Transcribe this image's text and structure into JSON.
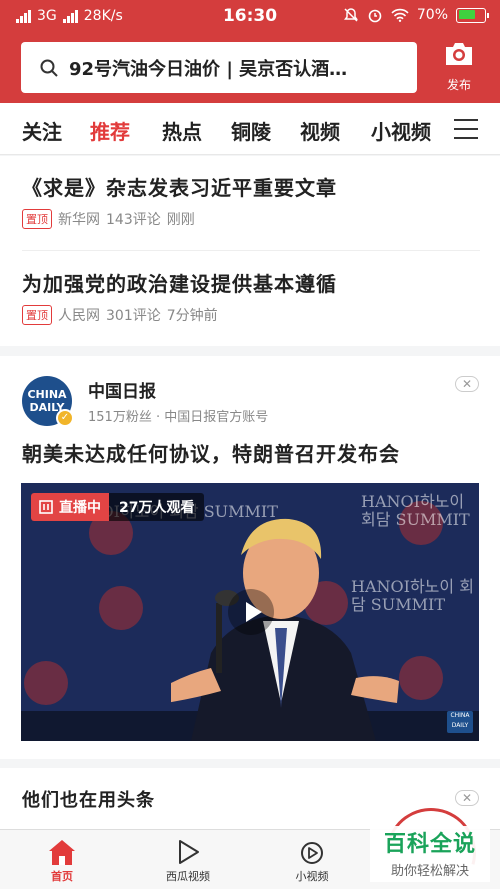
{
  "status_bar": {
    "network": "3G",
    "speed": "28K/s",
    "time": "16:30",
    "battery": "70%",
    "battery_level": 0.7
  },
  "header": {
    "search_text": "92号汽油今日油价 | 吴京否认酒…",
    "publish_label": "发布",
    "icons": [
      "search-icon",
      "camera-icon"
    ]
  },
  "tabs": [
    {
      "label": "关注",
      "active": false
    },
    {
      "label": "推荐",
      "active": true
    },
    {
      "label": "热点",
      "active": false
    },
    {
      "label": "铜陵",
      "active": false
    },
    {
      "label": "视频",
      "active": false
    },
    {
      "label": "小视频",
      "active": false
    }
  ],
  "news": [
    {
      "title": "《求是》杂志发表习近平重要文章",
      "badge": "置顶",
      "source": "新华网",
      "comments": "143评论",
      "time": "刚刚"
    },
    {
      "title": "为加强党的政治建设提供基本遵循",
      "badge": "置顶",
      "source": "人民网",
      "comments": "301评论",
      "time": "7分钟前"
    }
  ],
  "video_card": {
    "avatar_text": "CHINA DAILY",
    "account": "中国日报",
    "followers": "151万粉丝 · 中国日报官方账号",
    "title": "朝美未达成任何协议，特朗普召开发布会",
    "live_label": "直播中",
    "viewers": "27万人观看",
    "bg_text": "HANOI하노이 회담 SUMMIT",
    "watermark": "CHINA DAILY"
  },
  "suggest_card": {
    "title": "他们也在用头条"
  },
  "bottom_nav": [
    {
      "label": "首页",
      "icon": "home-icon",
      "active": true
    },
    {
      "label": "西瓜视频",
      "icon": "play-icon",
      "active": false
    },
    {
      "label": "小视频",
      "icon": "short-video-icon",
      "active": false
    }
  ],
  "overlay_watermark": {
    "big": "百科全说",
    "small": "助你轻松解决"
  },
  "colors": {
    "brand_red": "#d43d3d",
    "active_tab": "#e23b3b",
    "watermark_green": "#1aa35a"
  }
}
